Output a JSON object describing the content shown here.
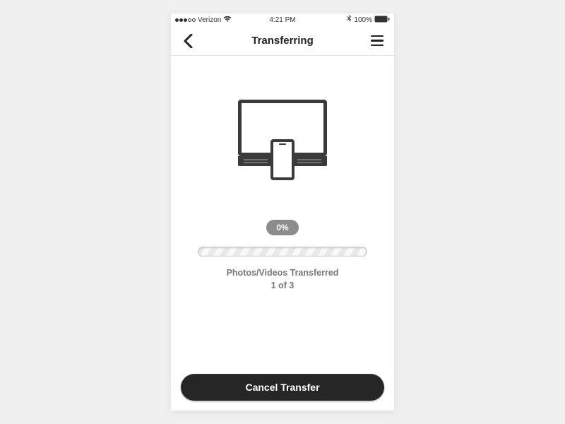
{
  "statusbar": {
    "carrier": "Verizon",
    "time": "4:21 PM",
    "battery": "100%",
    "signal_filled": 3,
    "signal_total": 5
  },
  "navbar": {
    "title": "Transferring"
  },
  "progress": {
    "percent_label": "0%",
    "value": 0,
    "total": 100
  },
  "status": {
    "label": "Photos/Videos Transferred",
    "count_label": "1 of 3",
    "current": 1,
    "total": 3
  },
  "buttons": {
    "cancel": "Cancel Transfer"
  },
  "icons": {
    "bluetooth": "bluetooth",
    "wifi": "wifi"
  }
}
